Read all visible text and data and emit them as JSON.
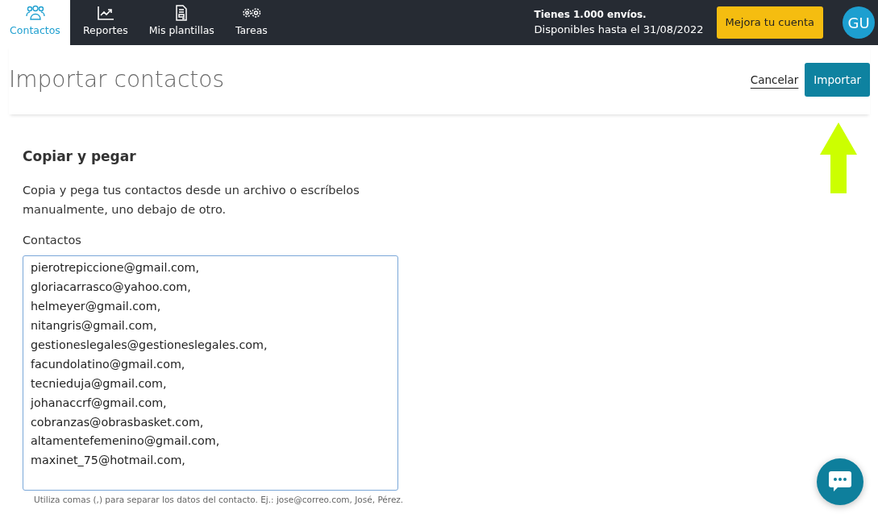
{
  "nav": {
    "items": [
      {
        "label": "Contactos",
        "selected": true
      },
      {
        "label": "Reportes",
        "selected": false
      },
      {
        "label": "Mis plantillas",
        "selected": false
      },
      {
        "label": "Tareas",
        "selected": false
      }
    ],
    "plan": {
      "title": "Tienes 1.000 envíos.",
      "subtitle": "Disponibles hasta el 31/08/2022"
    },
    "upgrade_button": "Mejora tu cuenta",
    "avatar": "GU"
  },
  "header": {
    "title": "Importar contactos",
    "cancel": "Cancelar",
    "import": "Importar"
  },
  "section": {
    "title": "Copiar y pegar",
    "description": "Copia y pega tus contactos desde un archivo o escríbelos manualmente, uno debajo de otro.",
    "field_label": "Contactos",
    "value": [
      "pierotrepiccione@gmail.com,",
      "gloriacarrasco@yahoo.com,",
      "helmeyer@gmail.com,",
      "nitangris@gmail.com,",
      "gestioneslegales@gestioneslegales.com,",
      "facundolatino@gmail.com,",
      "tecnieduja@gmail.com,",
      "johanaccrf@gmail.com,",
      "cobranzas@obrasbasket.com,",
      "altamentefemenino@gmail.com,",
      "maxinet_75@hotmail.com,"
    ],
    "help": "Utiliza comas (,) para separar los datos del contacto. Ej.: jose@correo.com, José, Pérez."
  }
}
